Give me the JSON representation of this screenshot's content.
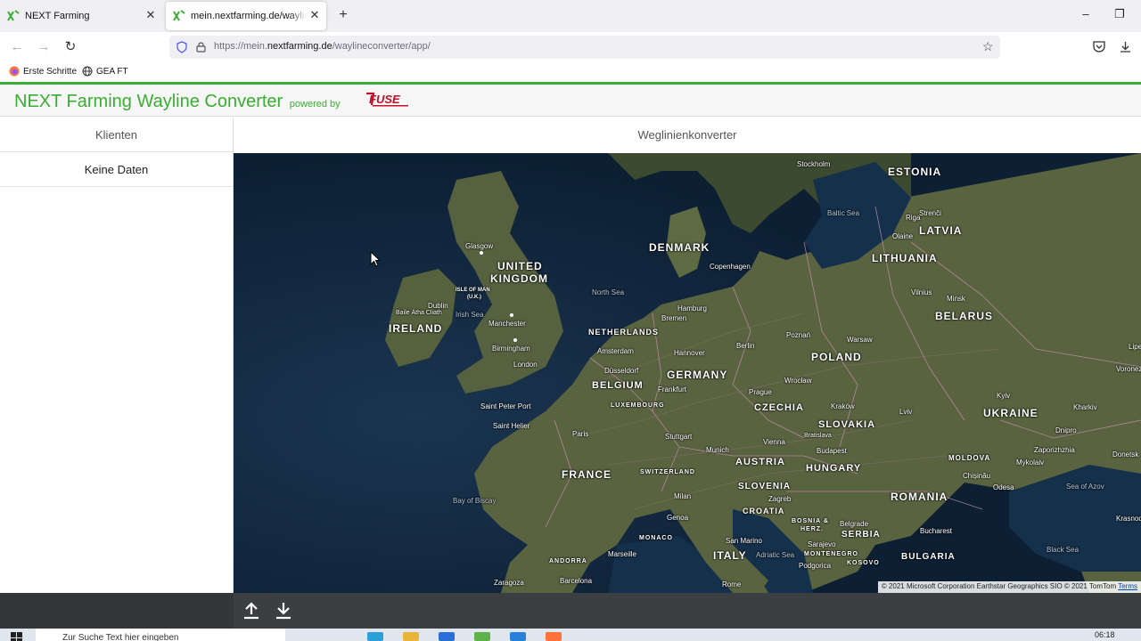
{
  "browser": {
    "tabs": [
      {
        "title": "NEXT Farming",
        "active": false
      },
      {
        "title": "mein.nextfarming.de/waylineconverter/app/",
        "active": true
      }
    ],
    "url": {
      "prefix": "https://mein.",
      "domain": "nextfarming.de",
      "path": "/waylineconverter/app/"
    },
    "bookmarks": [
      "Erste Schritte",
      "GEA FT"
    ]
  },
  "app": {
    "brand": {
      "next": "NEXT",
      "product": "Farming Wayline Converter",
      "powered": "powered by",
      "partner": "FUSE"
    },
    "accent": "#3aae32"
  },
  "sidebar": {
    "title": "Klienten",
    "empty_text": "Keine Daten"
  },
  "main": {
    "title": "Weglinienkonverter"
  },
  "map": {
    "countries": [
      "ESTONIA",
      "LATVIA",
      "LITHUANIA",
      "DENMARK",
      "UNITED",
      "KINGDOM",
      "IRELAND",
      "NETHERLANDS",
      "BELARUS",
      "POLAND",
      "GERMANY",
      "BELGIUM",
      "CZECHIA",
      "SLOVAKIA",
      "UKRAINE",
      "LUXEMBOURG",
      "AUSTRIA",
      "HUNGARY",
      "FRANCE",
      "SWITZERLAND",
      "SLOVENIA",
      "MOLDOVA",
      "ROMANIA",
      "CROATIA",
      "BOSNIA &",
      "HERZ.",
      "SERBIA",
      "MONACO",
      "ITALY",
      "MONTENEGRO",
      "KOSOVO",
      "BULGARIA",
      "ANDORRA",
      "ISLE OF MAN",
      "(U.K.)"
    ],
    "cities": [
      "Stockholm",
      "Riga",
      "Strenči",
      "Olaine",
      "Glasgow",
      "Copenhagen",
      "Vilnius",
      "Minsk",
      "Dublin",
      "Baile Átha Cliath",
      "Manchester",
      "Hamburg",
      "Bremen",
      "Berlin",
      "Poznań",
      "Warsaw",
      "Birmingham",
      "Amsterdam",
      "Hannover",
      "London",
      "Düsseldorf",
      "Frankfurt",
      "Wrocław",
      "Prague",
      "Kraków",
      "Lviv",
      "Kyiv",
      "Kharkiv",
      "Dnipro",
      "Saint Peter Port",
      "Saint Helier",
      "Paris",
      "Stuttgart",
      "Munich",
      "Vienna",
      "Bratislava",
      "Budapest",
      "Zaporizhzhia",
      "Mykolaiv",
      "Donetsk",
      "Chișinău",
      "Odesa",
      "Milan",
      "Genoa",
      "Zagreb",
      "Belgrade",
      "Sarajevo",
      "Podgorica",
      "San Marino",
      "Marseille",
      "Bucharest",
      "Barcelona",
      "Zaragoza",
      "Rome",
      "Lipe",
      "Voronez",
      "Krasnod"
    ],
    "seas": [
      "Baltic Sea",
      "North Sea",
      "Irish Sea",
      "Adriatic Sea",
      "Bay of Biscay",
      "Sea of Azov",
      "Black Sea"
    ],
    "copyright": "© 2021 Microsoft Corporation Earthstar Geographics SIO © 2021 TomTom",
    "terms_label": "Terms"
  },
  "toolbar": {
    "upload_icon": "upload-icon",
    "download_icon": "download-icon"
  },
  "taskbar": {
    "search_placeholder": "Zur Suche Text hier eingeben",
    "time": "06:18"
  }
}
